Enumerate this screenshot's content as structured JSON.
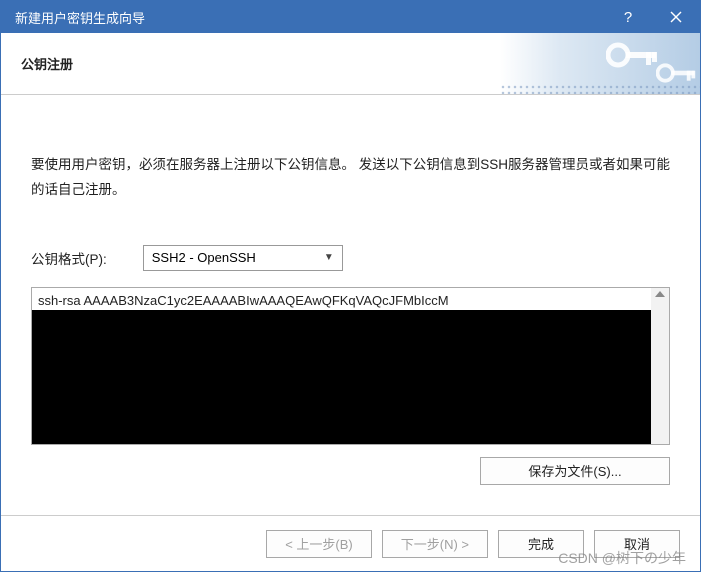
{
  "window": {
    "title": "新建用户密钥生成向导"
  },
  "banner": {
    "title": "公钥注册"
  },
  "instruction": "要使用用户密钥，必须在服务器上注册以下公钥信息。 发送以下公钥信息到SSH服务器管理员或者如果可能的话自己注册。",
  "format": {
    "label": "公钥格式(P):",
    "selected": "SSH2 - OpenSSH"
  },
  "pubkey": {
    "text": "ssh-rsa AAAAB3NzaC1yc2EAAAABIwAAAQEAwQFKqVAQcJFMbIccM"
  },
  "buttons": {
    "save": "保存为文件(S)...",
    "back": "< 上一步(B)",
    "next": "下一步(N) >",
    "finish": "完成",
    "cancel": "取消"
  },
  "watermark": "CSDN @树下の少年"
}
